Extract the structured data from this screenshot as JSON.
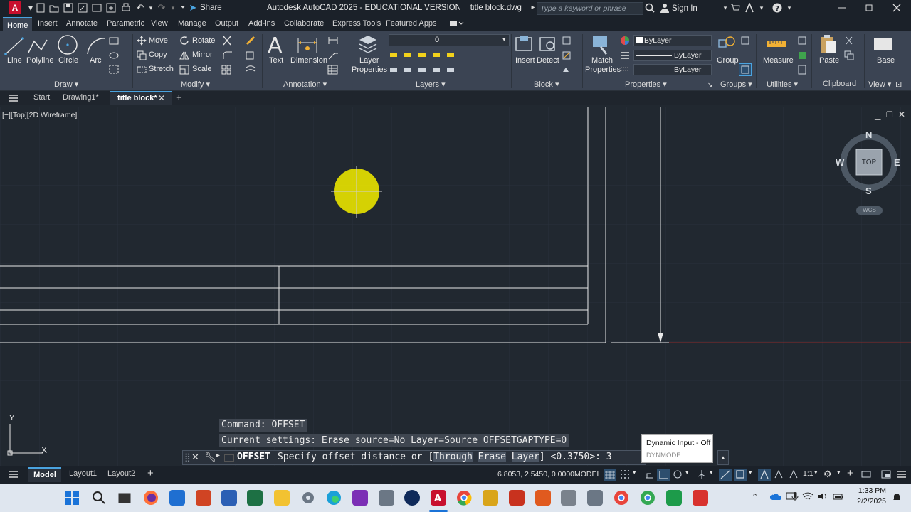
{
  "titlebar": {
    "app_logo": "A",
    "share_label": "Share",
    "window_title": "Autodesk AutoCAD 2025 - EDUCATIONAL VERSION",
    "file_name": "title block.dwg",
    "search_placeholder": "Type a keyword or phrase",
    "sign_in": "Sign In"
  },
  "ribbon_tabs": [
    "Home",
    "Insert",
    "Annotate",
    "Parametric",
    "View",
    "Manage",
    "Output",
    "Add-ins",
    "Collaborate",
    "Express Tools",
    "Featured Apps"
  ],
  "ribbon": {
    "draw": {
      "label": "Draw",
      "line": "Line",
      "polyline": "Polyline",
      "circle": "Circle",
      "arc": "Arc"
    },
    "modify": {
      "label": "Modify",
      "move": "Move",
      "rotate": "Rotate",
      "copy": "Copy",
      "mirror": "Mirror",
      "stretch": "Stretch",
      "scale": "Scale"
    },
    "annotation": {
      "label": "Annotation",
      "text": "Text",
      "dimension": "Dimension"
    },
    "layers": {
      "label": "Layers",
      "layer_properties_1": "Layer",
      "layer_properties_2": "Properties",
      "current_layer": "0"
    },
    "block": {
      "label": "Block",
      "insert": "Insert",
      "detect": "Detect"
    },
    "properties": {
      "label": "Properties",
      "match_1": "Match",
      "match_2": "Properties",
      "color": "ByLayer",
      "linetype": "ByLayer",
      "lineweight": "ByLayer"
    },
    "groups": {
      "label": "Groups",
      "group": "Group"
    },
    "utilities": {
      "label": "Utilities",
      "measure": "Measure"
    },
    "clipboard": {
      "label": "Clipboard",
      "paste": "Paste"
    },
    "view": {
      "label": "View",
      "base": "Base"
    }
  },
  "file_tabs": {
    "start": "Start",
    "drawing1": "Drawing1*",
    "title_block": "title block*"
  },
  "viewport": {
    "label": "[−][Top][2D Wireframe]"
  },
  "viewcube": {
    "north": "N",
    "south": "S",
    "east": "E",
    "west": "W",
    "face": "TOP",
    "wcs": "WCS"
  },
  "ucs": {
    "x": "X",
    "y": "Y"
  },
  "command": {
    "history_1": "Command: OFFSET",
    "history_2": "Current settings: Erase source=No  Layer=Source  OFFSETGAPTYPE=0",
    "prompt_name": "OFFSET",
    "prompt_text": "Specify offset distance or [",
    "opt_through": "Through",
    "opt_erase": "Erase",
    "opt_layer": "Layer",
    "prompt_default": "] <0.3750>: 3"
  },
  "tooltip": {
    "title": "Dynamic Input - Off",
    "sub": "DYNMODE"
  },
  "layout_tabs": {
    "model": "Model",
    "layout1": "Layout1",
    "layout2": "Layout2"
  },
  "status": {
    "coords": "6.8053, 2.5450, 0.0000",
    "mode": "MODEL",
    "scale": "1:1"
  },
  "taskbar": {
    "time": "1:33 PM",
    "date": "2/2/2025"
  },
  "colors": {
    "accent": "#4aa3df",
    "highlight_circle": "#e5e000",
    "canvas": "#212830",
    "autocad_red": "#c8102e"
  }
}
